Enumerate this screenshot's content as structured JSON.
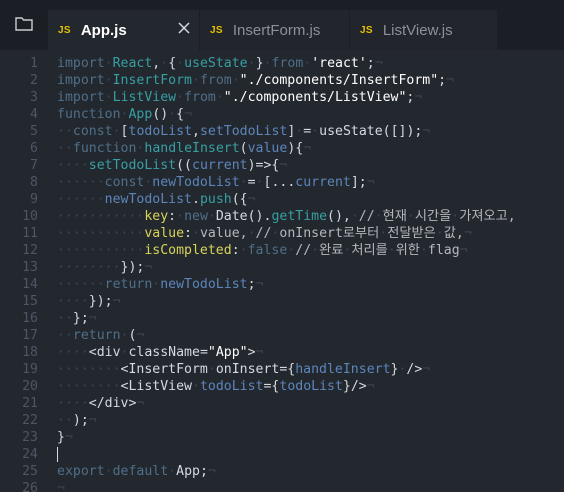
{
  "tabs": [
    {
      "badge": "JS",
      "label": "App.js",
      "active": true,
      "close_icon": "close-icon"
    },
    {
      "badge": "JS",
      "label": "InsertForm.js",
      "active": false
    },
    {
      "badge": "JS",
      "label": "ListView.js",
      "active": false
    }
  ],
  "sidebar": {
    "icon": "files-explorer-icon"
  },
  "colors": {
    "background": "#23272e",
    "tabbar": "#1b1e24",
    "keyword": "#4f6f89",
    "function": "#36a0a3",
    "string": "#ffffff",
    "variable": "#5c86bb",
    "property": "#d8d45a",
    "whitespace_marker": "#3d4654",
    "line_number": "#4f5663"
  },
  "editor": {
    "lines": [
      {
        "n": "1",
        "tokens": [
          [
            "kw",
            "import"
          ],
          [
            "ws",
            "·"
          ],
          [
            "fn",
            "React"
          ],
          [
            "pl",
            ","
          ],
          [
            "ws",
            "·"
          ],
          [
            "pl",
            "{"
          ],
          [
            "ws",
            "·"
          ],
          [
            "fn",
            "useState"
          ],
          [
            "ws",
            "·"
          ],
          [
            "pl",
            "}"
          ],
          [
            "ws",
            "·"
          ],
          [
            "kw",
            "from"
          ],
          [
            "ws",
            "·"
          ],
          [
            "str",
            "'react'"
          ],
          [
            "pl",
            ";"
          ],
          [
            "ws",
            "¬"
          ]
        ]
      },
      {
        "n": "2",
        "tokens": [
          [
            "kw",
            "import"
          ],
          [
            "ws",
            "·"
          ],
          [
            "fn",
            "InsertForm"
          ],
          [
            "ws",
            "·"
          ],
          [
            "kw",
            "from"
          ],
          [
            "ws",
            "·"
          ],
          [
            "str",
            "\"./components/InsertForm\""
          ],
          [
            "pl",
            ";"
          ],
          [
            "ws",
            "¬"
          ]
        ]
      },
      {
        "n": "3",
        "tokens": [
          [
            "kw",
            "import"
          ],
          [
            "ws",
            "·"
          ],
          [
            "fn",
            "ListView"
          ],
          [
            "ws",
            "·"
          ],
          [
            "kw",
            "from"
          ],
          [
            "ws",
            "·"
          ],
          [
            "str",
            "\"./components/ListView\""
          ],
          [
            "pl",
            ";"
          ],
          [
            "ws",
            "¬"
          ]
        ]
      },
      {
        "n": "4",
        "tokens": [
          [
            "kw",
            "function"
          ],
          [
            "ws",
            "·"
          ],
          [
            "fn",
            "App"
          ],
          [
            "pl",
            "()"
          ],
          [
            "ws",
            "·"
          ],
          [
            "pl",
            "{"
          ],
          [
            "ws",
            "¬"
          ]
        ]
      },
      {
        "n": "5",
        "tokens": [
          [
            "ws",
            "··"
          ],
          [
            "kw",
            "const"
          ],
          [
            "ws",
            "·"
          ],
          [
            "pl",
            "["
          ],
          [
            "var",
            "todoList"
          ],
          [
            "pl",
            ","
          ],
          [
            "var",
            "setTodoList"
          ],
          [
            "pl",
            "]"
          ],
          [
            "ws",
            "·"
          ],
          [
            "pl",
            "="
          ],
          [
            "ws",
            "·"
          ],
          [
            "pl",
            "useState([]);"
          ],
          [
            "ws",
            "¬"
          ]
        ]
      },
      {
        "n": "6",
        "tokens": [
          [
            "ws",
            "··"
          ],
          [
            "kw",
            "function"
          ],
          [
            "ws",
            "·"
          ],
          [
            "fn",
            "handleInsert"
          ],
          [
            "pl",
            "("
          ],
          [
            "var",
            "value"
          ],
          [
            "pl",
            "){"
          ],
          [
            "ws",
            "¬"
          ]
        ]
      },
      {
        "n": "7",
        "tokens": [
          [
            "ws",
            "····"
          ],
          [
            "fn",
            "setTodoList"
          ],
          [
            "pl",
            "(("
          ],
          [
            "var",
            "current"
          ],
          [
            "pl",
            ")=>{"
          ],
          [
            "ws",
            "¬"
          ]
        ]
      },
      {
        "n": "8",
        "tokens": [
          [
            "ws",
            "······"
          ],
          [
            "kw",
            "const"
          ],
          [
            "ws",
            "·"
          ],
          [
            "var",
            "newTodoList"
          ],
          [
            "ws",
            "·"
          ],
          [
            "pl",
            "="
          ],
          [
            "ws",
            "·"
          ],
          [
            "pl",
            "[..."
          ],
          [
            "var",
            "current"
          ],
          [
            "pl",
            "];"
          ],
          [
            "ws",
            "¬"
          ]
        ]
      },
      {
        "n": "9",
        "tokens": [
          [
            "ws",
            "······"
          ],
          [
            "var",
            "newTodoList"
          ],
          [
            "pl",
            "."
          ],
          [
            "fn",
            "push"
          ],
          [
            "pl",
            "({"
          ],
          [
            "ws",
            "¬"
          ]
        ]
      },
      {
        "n": "10",
        "tokens": [
          [
            "ws",
            "···········"
          ],
          [
            "prop",
            "key"
          ],
          [
            "pl",
            ":"
          ],
          [
            "ws",
            "·"
          ],
          [
            "kw",
            "new"
          ],
          [
            "ws",
            "·"
          ],
          [
            "pl",
            "Date()."
          ],
          [
            "fn",
            "getTime"
          ],
          [
            "pl",
            "(),"
          ],
          [
            "ws",
            "·"
          ],
          [
            "cm",
            "//"
          ],
          [
            "ws",
            "·"
          ],
          [
            "cm",
            "현재"
          ],
          [
            "ws",
            "·"
          ],
          [
            "cm",
            "시간을"
          ],
          [
            "ws",
            "·"
          ],
          [
            "cm",
            "가져오고,"
          ]
        ]
      },
      {
        "n": "11",
        "tokens": [
          [
            "ws",
            "···········"
          ],
          [
            "prop",
            "value"
          ],
          [
            "pl",
            ":"
          ],
          [
            "ws",
            "·"
          ],
          [
            "cm",
            "value,"
          ],
          [
            "ws",
            "·"
          ],
          [
            "cm",
            "//"
          ],
          [
            "ws",
            "·"
          ],
          [
            "cm",
            "onInsert로부터"
          ],
          [
            "ws",
            "·"
          ],
          [
            "cm",
            "전달받은"
          ],
          [
            "ws",
            "·"
          ],
          [
            "cm",
            "값,"
          ],
          [
            "ws",
            "¬"
          ]
        ]
      },
      {
        "n": "12",
        "tokens": [
          [
            "ws",
            "···········"
          ],
          [
            "prop",
            "isCompleted"
          ],
          [
            "pl",
            ":"
          ],
          [
            "ws",
            "·"
          ],
          [
            "kw",
            "false"
          ],
          [
            "ws",
            "·"
          ],
          [
            "cm",
            "//"
          ],
          [
            "ws",
            "·"
          ],
          [
            "cm",
            "완료"
          ],
          [
            "ws",
            "·"
          ],
          [
            "cm",
            "처리를"
          ],
          [
            "ws",
            "·"
          ],
          [
            "cm",
            "위한"
          ],
          [
            "ws",
            "·"
          ],
          [
            "cm",
            "flag"
          ],
          [
            "ws",
            "¬"
          ]
        ]
      },
      {
        "n": "13",
        "tokens": [
          [
            "ws",
            "········"
          ],
          [
            "pl",
            "});"
          ],
          [
            "ws",
            "¬"
          ]
        ]
      },
      {
        "n": "14",
        "tokens": [
          [
            "ws",
            "······"
          ],
          [
            "kw",
            "return"
          ],
          [
            "ws",
            "·"
          ],
          [
            "var",
            "newTodoList"
          ],
          [
            "pl",
            ";"
          ],
          [
            "ws",
            "¬"
          ]
        ]
      },
      {
        "n": "15",
        "tokens": [
          [
            "ws",
            "····"
          ],
          [
            "pl",
            "});"
          ],
          [
            "ws",
            "¬"
          ]
        ]
      },
      {
        "n": "16",
        "tokens": [
          [
            "ws",
            "··"
          ],
          [
            "pl",
            "};"
          ],
          [
            "ws",
            "¬"
          ]
        ]
      },
      {
        "n": "17",
        "tokens": [
          [
            "ws",
            "··"
          ],
          [
            "kw",
            "return"
          ],
          [
            "ws",
            "·"
          ],
          [
            "pl",
            "("
          ],
          [
            "ws",
            "¬"
          ]
        ]
      },
      {
        "n": "18",
        "tokens": [
          [
            "ws",
            "····"
          ],
          [
            "pl",
            "<div"
          ],
          [
            "ws",
            "·"
          ],
          [
            "pl",
            "className="
          ],
          [
            "str",
            "\"App\""
          ],
          [
            "pl",
            ">"
          ],
          [
            "ws",
            "¬"
          ]
        ]
      },
      {
        "n": "19",
        "tokens": [
          [
            "ws",
            "········"
          ],
          [
            "pl",
            "<InsertForm"
          ],
          [
            "ws",
            "·"
          ],
          [
            "pl",
            "onInsert={"
          ],
          [
            "var",
            "handleInsert"
          ],
          [
            "pl",
            "}"
          ],
          [
            "ws",
            "·"
          ],
          [
            "pl",
            "/>"
          ],
          [
            "ws",
            "¬"
          ]
        ]
      },
      {
        "n": "20",
        "tokens": [
          [
            "ws",
            "········"
          ],
          [
            "pl",
            "<ListView"
          ],
          [
            "ws",
            "·"
          ],
          [
            "var",
            "todoList"
          ],
          [
            "pl",
            "={"
          ],
          [
            "var",
            "todoList"
          ],
          [
            "pl",
            "}/>"
          ],
          [
            "ws",
            "¬"
          ]
        ]
      },
      {
        "n": "21",
        "tokens": [
          [
            "ws",
            "····"
          ],
          [
            "pl",
            "</div>"
          ],
          [
            "ws",
            "¬"
          ]
        ]
      },
      {
        "n": "22",
        "tokens": [
          [
            "ws",
            "··"
          ],
          [
            "pl",
            ");"
          ],
          [
            "ws",
            "¬"
          ]
        ]
      },
      {
        "n": "23",
        "tokens": [
          [
            "pl",
            "}"
          ],
          [
            "ws",
            "¬"
          ]
        ]
      },
      {
        "n": "24",
        "tokens": [],
        "cursor": true
      },
      {
        "n": "25",
        "tokens": [
          [
            "kw",
            "export"
          ],
          [
            "ws",
            "·"
          ],
          [
            "kw",
            "default"
          ],
          [
            "ws",
            "·"
          ],
          [
            "pl",
            "App;"
          ],
          [
            "ws",
            "¬"
          ]
        ]
      },
      {
        "n": "26",
        "tokens": [
          [
            "ws",
            "¬"
          ]
        ]
      }
    ]
  }
}
